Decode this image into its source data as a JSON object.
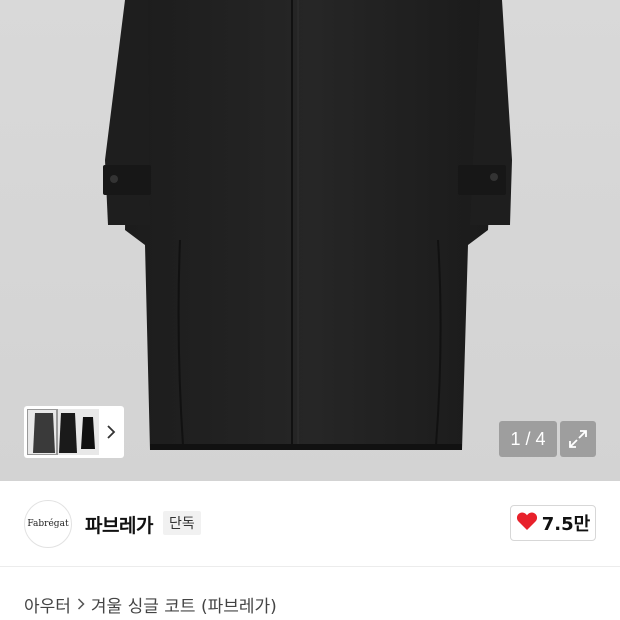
{
  "product": {
    "image_alt": "black single coat",
    "pager": "1 / 4",
    "thumbnail_next": "next-thumbnail"
  },
  "brand": {
    "logo_text": "Fabrégat",
    "name": "파브레가",
    "badge": "단독"
  },
  "like": {
    "count": "7.5만",
    "color": "#e8212b"
  },
  "breadcrumb": {
    "category": "아우터",
    "title": "겨울 싱글 코트 (파브레가)"
  }
}
